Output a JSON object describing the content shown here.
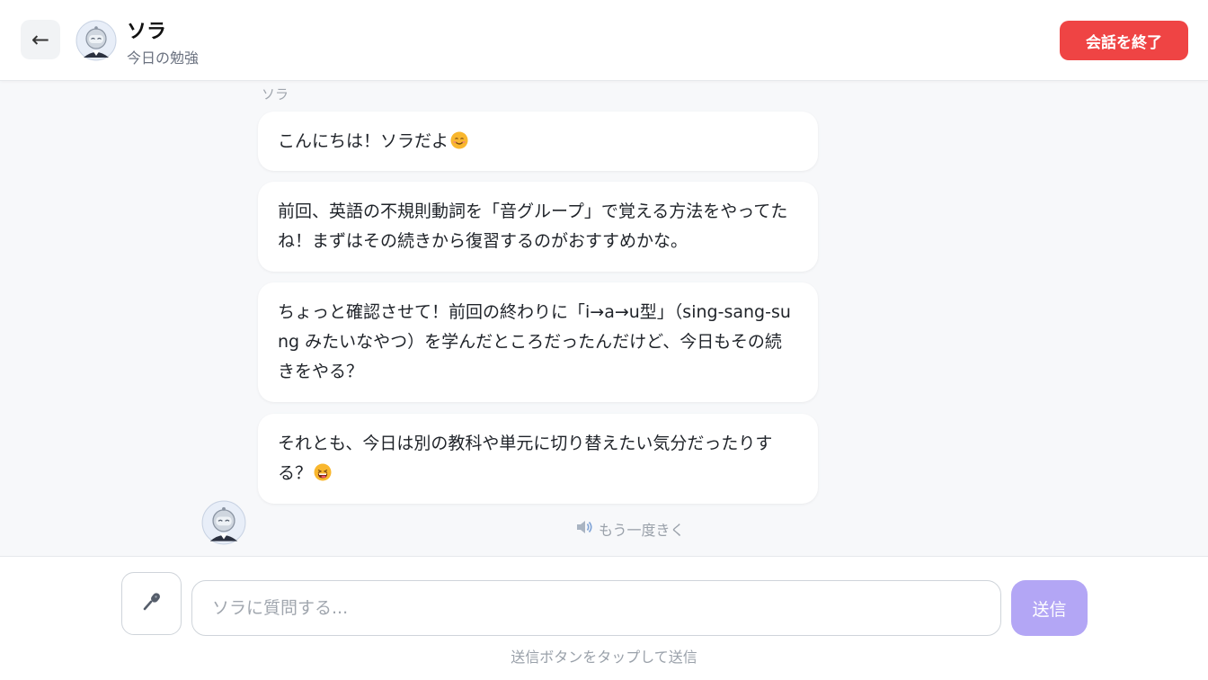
{
  "header": {
    "back_icon": "←",
    "name": "ソラ",
    "subtitle": "今日の勉強",
    "end_button": "会話を終了",
    "end_button_color": "#ef4444"
  },
  "chat": {
    "sender": "ソラ",
    "messages": [
      {
        "text": "こんにちは！ソラだよ",
        "emoji": "smiling-face-emoji"
      },
      {
        "text": "前回、英語の不規則動詞を「音グループ」で覚える方法をやってたね！まずはその続きから復習するのがおすすめかな。"
      },
      {
        "text": "ちょっと確認させて！前回の終わりに「i→a→u型」（sing-sang-sung みたいなやつ）を学んだところだったんだけど、今日もその続きをやる？"
      },
      {
        "text": "それとも、今日は別の教科や単元に切り替えたい気分だったりする？",
        "emoji": "grinning-face-emoji"
      }
    ],
    "replay_label": "もう一度きく",
    "replay_icon": "speaker-icon"
  },
  "input": {
    "mic_icon": "microphone-icon",
    "placeholder": "ソラに質問する...",
    "value": "",
    "send_label": "送信",
    "send_color": "#b3a6f5",
    "hint": "送信ボタンをタップして送信"
  }
}
